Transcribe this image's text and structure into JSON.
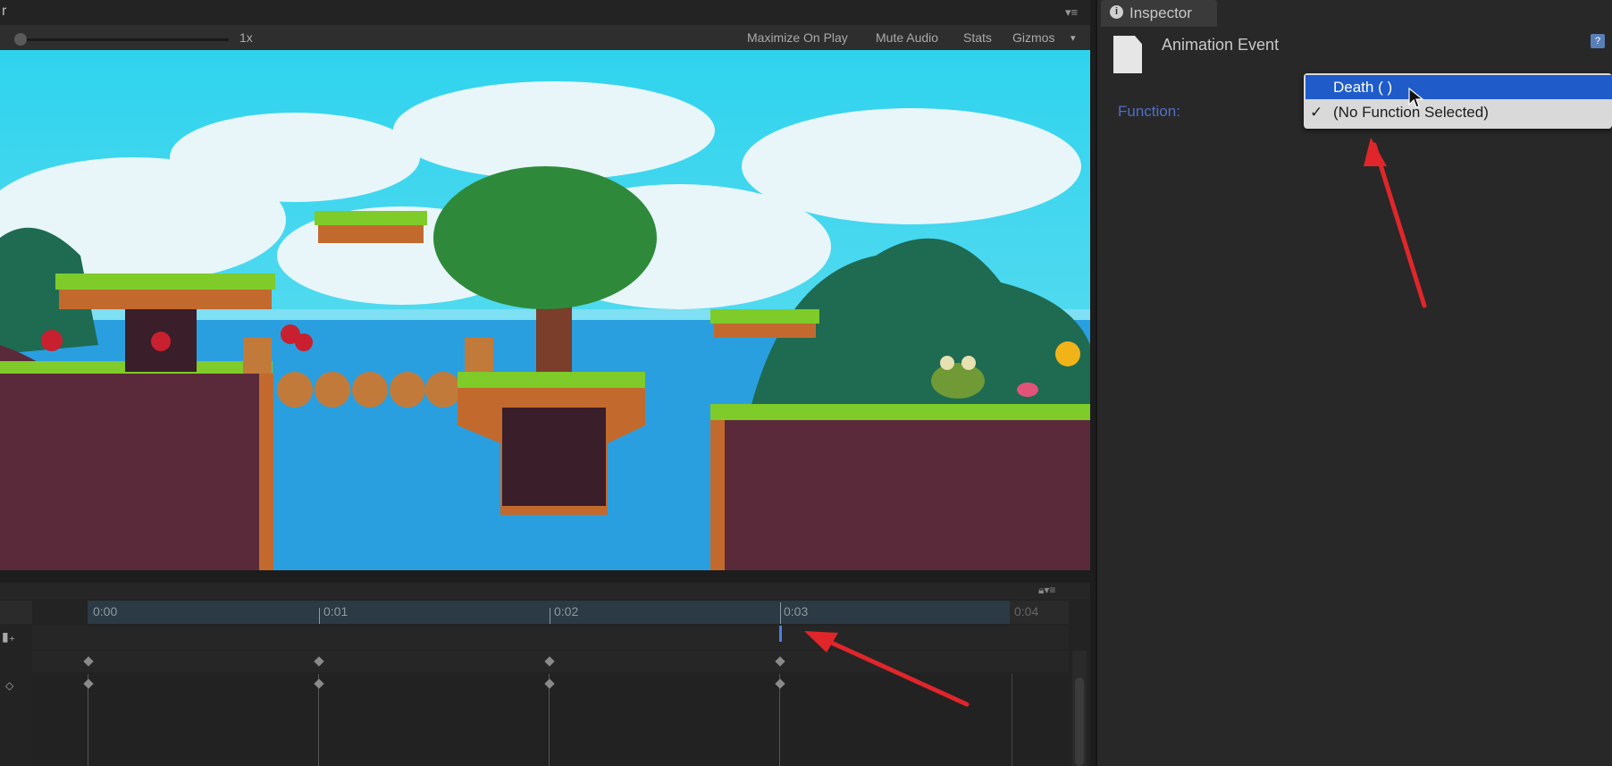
{
  "game_view": {
    "title_fragment": "r",
    "scale_label": "1x",
    "toolbar": {
      "maximize_on_play": "Maximize On Play",
      "mute_audio": "Mute Audio",
      "stats": "Stats",
      "gizmos": "Gizmos"
    }
  },
  "timeline": {
    "ticks": [
      "0:00",
      "0:01",
      "0:02",
      "0:03",
      "0:04"
    ]
  },
  "inspector": {
    "tab_label": "Inspector",
    "component_title": "Animation Event",
    "function_label": "Function:",
    "dropdown": {
      "options": [
        "Death ( )",
        "(No Function Selected)"
      ],
      "highlighted": "Death ( )",
      "checked": "(No Function Selected)",
      "check_mark": "✓"
    }
  },
  "colors": {
    "highlight": "#1f5cc9",
    "annotation_arrow": "#e0262a",
    "sky": "#33c9e8",
    "water": "#2a9fe0"
  }
}
